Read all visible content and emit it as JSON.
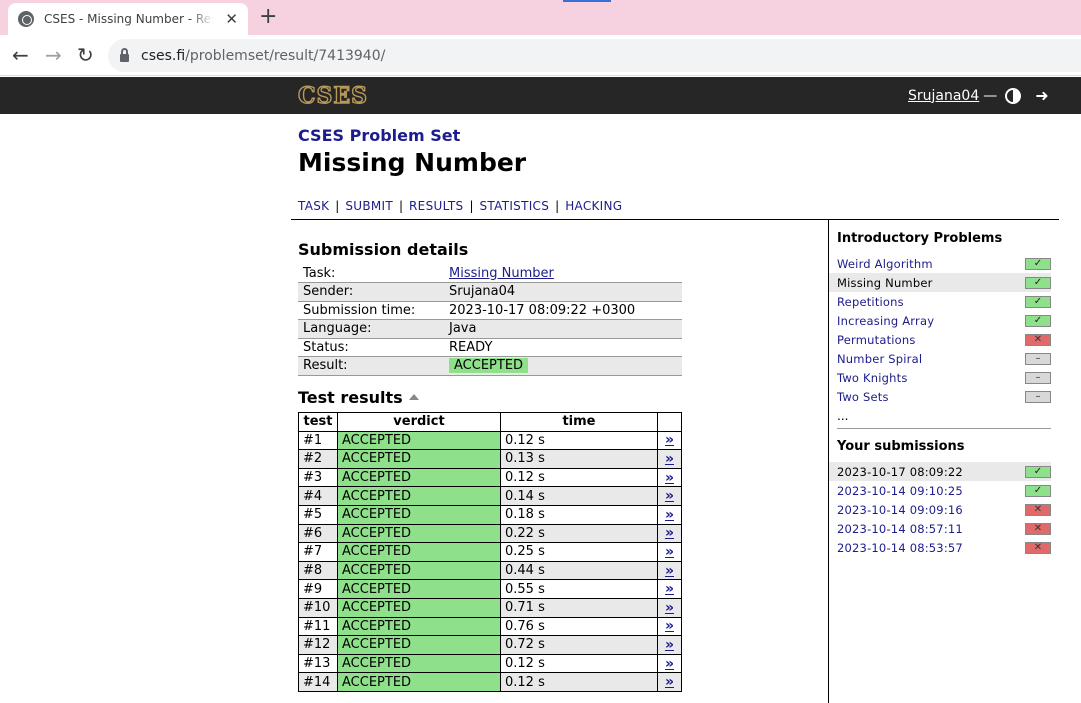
{
  "browser": {
    "tab_title": "CSES - Missing Number - Results",
    "tab_close": "✕",
    "new_tab": "+",
    "url_domain": "cses.fi",
    "url_path": "/problemset/result/7413940/"
  },
  "header": {
    "logo": "CSES",
    "username": "Srujana04",
    "dash": "—"
  },
  "page": {
    "subtitle": "CSES Problem Set",
    "title": "Missing Number",
    "nav": [
      "TASK",
      "SUBMIT",
      "RESULTS",
      "STATISTICS",
      "HACKING"
    ]
  },
  "submission": {
    "heading": "Submission details",
    "rows": [
      {
        "key": "Task:",
        "value": "Missing Number"
      },
      {
        "key": "Sender:",
        "value": "Srujana04"
      },
      {
        "key": "Submission time:",
        "value": "2023-10-17 08:09:22 +0300"
      },
      {
        "key": "Language:",
        "value": "Java"
      },
      {
        "key": "Status:",
        "value": "READY"
      },
      {
        "key": "Result:",
        "value": "ACCEPTED"
      }
    ]
  },
  "tests": {
    "heading": "Test results",
    "columns": [
      "test",
      "verdict",
      "time"
    ],
    "link_glyph": "»",
    "rows": [
      {
        "test": "#1",
        "verdict": "ACCEPTED",
        "time": "0.12 s"
      },
      {
        "test": "#2",
        "verdict": "ACCEPTED",
        "time": "0.13 s"
      },
      {
        "test": "#3",
        "verdict": "ACCEPTED",
        "time": "0.12 s"
      },
      {
        "test": "#4",
        "verdict": "ACCEPTED",
        "time": "0.14 s"
      },
      {
        "test": "#5",
        "verdict": "ACCEPTED",
        "time": "0.18 s"
      },
      {
        "test": "#6",
        "verdict": "ACCEPTED",
        "time": "0.22 s"
      },
      {
        "test": "#7",
        "verdict": "ACCEPTED",
        "time": "0.25 s"
      },
      {
        "test": "#8",
        "verdict": "ACCEPTED",
        "time": "0.44 s"
      },
      {
        "test": "#9",
        "verdict": "ACCEPTED",
        "time": "0.55 s"
      },
      {
        "test": "#10",
        "verdict": "ACCEPTED",
        "time": "0.71 s"
      },
      {
        "test": "#11",
        "verdict": "ACCEPTED",
        "time": "0.76 s"
      },
      {
        "test": "#12",
        "verdict": "ACCEPTED",
        "time": "0.72 s"
      },
      {
        "test": "#13",
        "verdict": "ACCEPTED",
        "time": "0.12 s"
      },
      {
        "test": "#14",
        "verdict": "ACCEPTED",
        "time": "0.12 s"
      }
    ]
  },
  "sidebar": {
    "problems_heading": "Introductory Problems",
    "problems": [
      {
        "name": "Weird Algorithm",
        "status": "full",
        "mark": "✓"
      },
      {
        "name": "Missing Number",
        "status": "full",
        "mark": "✓"
      },
      {
        "name": "Repetitions",
        "status": "full",
        "mark": "✓"
      },
      {
        "name": "Increasing Array",
        "status": "full",
        "mark": "✓"
      },
      {
        "name": "Permutations",
        "status": "zero",
        "mark": "✕"
      },
      {
        "name": "Number Spiral",
        "status": "none",
        "mark": "–"
      },
      {
        "name": "Two Knights",
        "status": "none",
        "mark": "–"
      },
      {
        "name": "Two Sets",
        "status": "none",
        "mark": "–"
      }
    ],
    "more": "...",
    "submissions_heading": "Your submissions",
    "submissions": [
      {
        "time": "2023-10-17 08:09:22",
        "status": "full",
        "mark": "✓"
      },
      {
        "time": "2023-10-14 09:10:25",
        "status": "full",
        "mark": "✓"
      },
      {
        "time": "2023-10-14 09:09:16",
        "status": "zero",
        "mark": "✕"
      },
      {
        "time": "2023-10-14 08:57:11",
        "status": "zero",
        "mark": "✕"
      },
      {
        "time": "2023-10-14 08:53:57",
        "status": "zero",
        "mark": "✕"
      }
    ]
  },
  "colors": {
    "accepted": "#8fe08a",
    "failed": "#e06a6a",
    "link": "#1c1c8c",
    "header_bg": "#262626",
    "logo": "#b69858"
  }
}
